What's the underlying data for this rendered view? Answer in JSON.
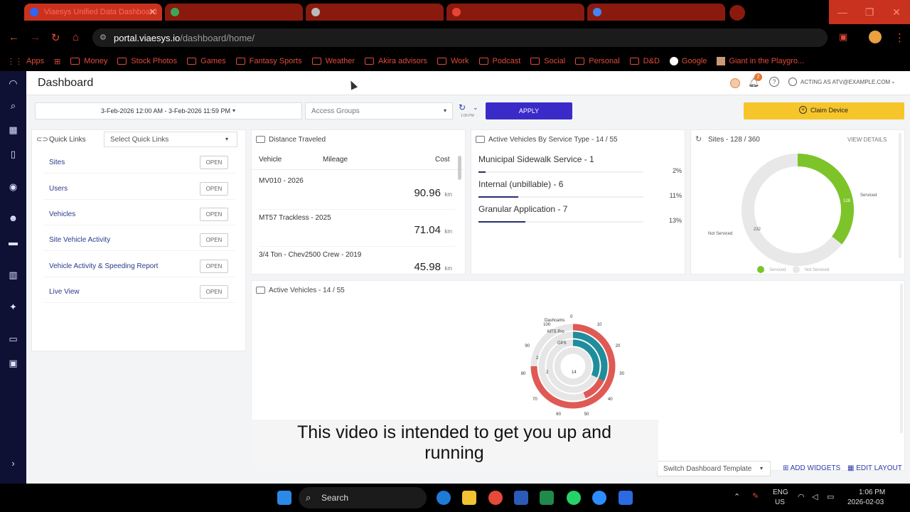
{
  "browser": {
    "tabs": [
      {
        "title": "Viaesys Unified Data Dashboard"
      },
      {
        "title": ""
      },
      {
        "title": ""
      },
      {
        "title": ""
      },
      {
        "title": ""
      }
    ],
    "url_host": "portal.viaesys.io",
    "url_path": "/dashboard/home/",
    "bookmarks": [
      "Apps",
      "Money",
      "Stock Photos",
      "Games",
      "Fantasy Sports",
      "Weather",
      "Akira advisors",
      "Work",
      "Podcast",
      "Social",
      "Personal",
      "D&D",
      "Google",
      "Giant in the Playgro..."
    ]
  },
  "header": {
    "title": "Dashboard",
    "notification_count": "2",
    "acting_as": "ACTING AS ATV@EXAMPLE.COM"
  },
  "filters": {
    "date_range": "3-Feb-2026 12:00 AM - 3-Feb-2026 11:59 PM",
    "access_groups_placeholder": "Access Groups",
    "refresh_time": "1:06 PM",
    "apply_label": "APPLY",
    "claim_label": "Claim Device"
  },
  "quick_links": {
    "title": "Quick Links",
    "select_placeholder": "Select Quick Links",
    "open_label": "OPEN",
    "items": [
      "Sites",
      "Users",
      "Vehicles",
      "Site Vehicle Activity",
      "Vehicle Activity & Speeding Report",
      "Live View"
    ]
  },
  "distance": {
    "title": "Distance Traveled",
    "columns": [
      "Vehicle",
      "Mileage",
      "Cost"
    ],
    "unit": "km",
    "rows": [
      {
        "vehicle": "MV010 - 2026",
        "value": "90.96"
      },
      {
        "vehicle": "MT57 Trackless - 2025",
        "value": "71.04"
      },
      {
        "vehicle": "3/4 Ton - Chev2500 Crew - 2019",
        "value": "45.98"
      }
    ]
  },
  "service_type": {
    "title": "Active Vehicles By Service Type - 14 / 55",
    "rows": [
      {
        "name": "Municipal Sidewalk Service - 1",
        "pct": "2%",
        "fill": 0.02
      },
      {
        "name": "Internal (unbillable) - 6",
        "pct": "11%",
        "fill": 0.11
      },
      {
        "name": "Granular Application - 7",
        "pct": "13%",
        "fill": 0.13
      }
    ]
  },
  "sites": {
    "title": "Sites - 128 / 360",
    "view_details": "VIEW DETAILS",
    "serviced_color": "#7dc32a",
    "not_serviced_color": "#e8e8e8",
    "legend": [
      "Serviced",
      "Not Serviced"
    ],
    "label_serviced": "Serviced",
    "label_not_serviced": "Not Serviced",
    "value_serviced": "128",
    "value_not_serviced": "232"
  },
  "chart_data": {
    "type": "pie",
    "title": "Sites - 128 / 360",
    "categories": [
      "Serviced",
      "Not Serviced"
    ],
    "values": [
      128,
      232
    ]
  },
  "active_vehicles": {
    "title": "Active Vehicles - 14 / 55",
    "ring_labels": [
      "Dashcams",
      "MTS Pro",
      "GPS"
    ],
    "ticks": [
      "0",
      "10",
      "20",
      "30",
      "40",
      "50",
      "60",
      "70",
      "80",
      "90",
      "100"
    ],
    "value_labels": [
      "6",
      "2",
      "2",
      "14"
    ],
    "red": "#e05a55",
    "teal": "#1f8e9c"
  },
  "footer": {
    "switch_template": "Switch Dashboard Template",
    "add_widgets": "ADD WIDGETS",
    "edit_layout": "EDIT LAYOUT"
  },
  "subtitle": {
    "line1": "This video is intended to get you up and",
    "line2": "running"
  },
  "taskbar": {
    "search": "Search",
    "lang1": "ENG",
    "lang2": "US",
    "time": "1:06 PM",
    "date": "2026-02-03"
  }
}
